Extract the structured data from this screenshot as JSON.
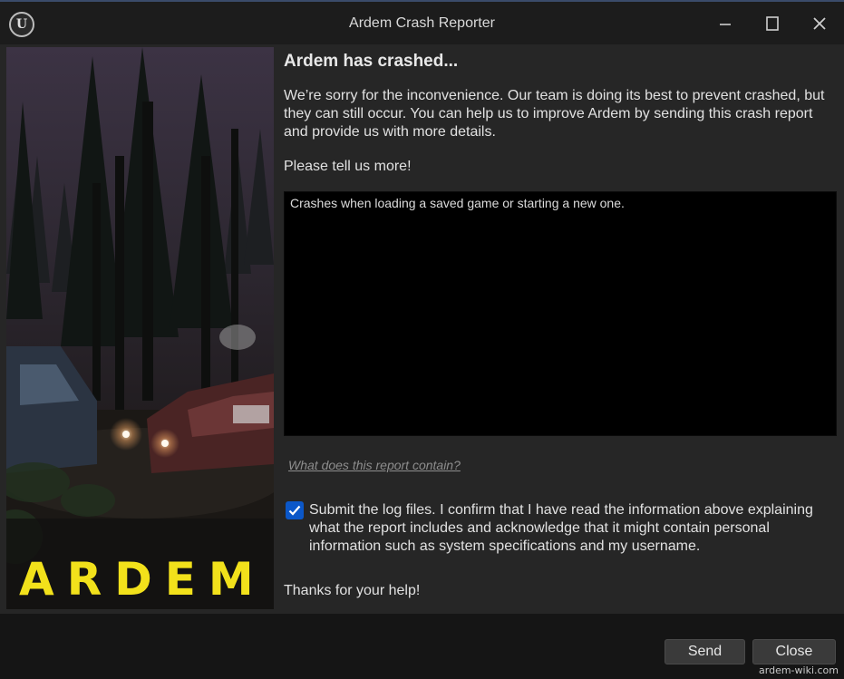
{
  "window": {
    "title": "Ardem Crash Reporter",
    "logo_letter": "U"
  },
  "splash": {
    "logo_text": "ARDEM"
  },
  "main": {
    "heading": "Ardem has crashed...",
    "message": "We’re sorry for the inconvenience. Our team is doing its best to prevent crashed, but they can still occur. You can help us to improve Ardem by sending this crash report and provide us with more details.",
    "tell_more": "Please tell us more!",
    "user_comment": "Crashes when loading a saved game or starting a new one.",
    "report_link": "What does this report contain?",
    "consent_checked": true,
    "consent_text": "Submit the log files. I confirm that I have read the information above explaining what the report includes and acknowledge that it might contain personal information such as system specifications and my username.",
    "thanks": "Thanks for your help!"
  },
  "buttons": {
    "send": "Send",
    "close": "Close"
  },
  "watermark": "ardem-wiki.com",
  "colors": {
    "accent": "#0b57c8",
    "logo_yellow": "#f2e11b"
  }
}
